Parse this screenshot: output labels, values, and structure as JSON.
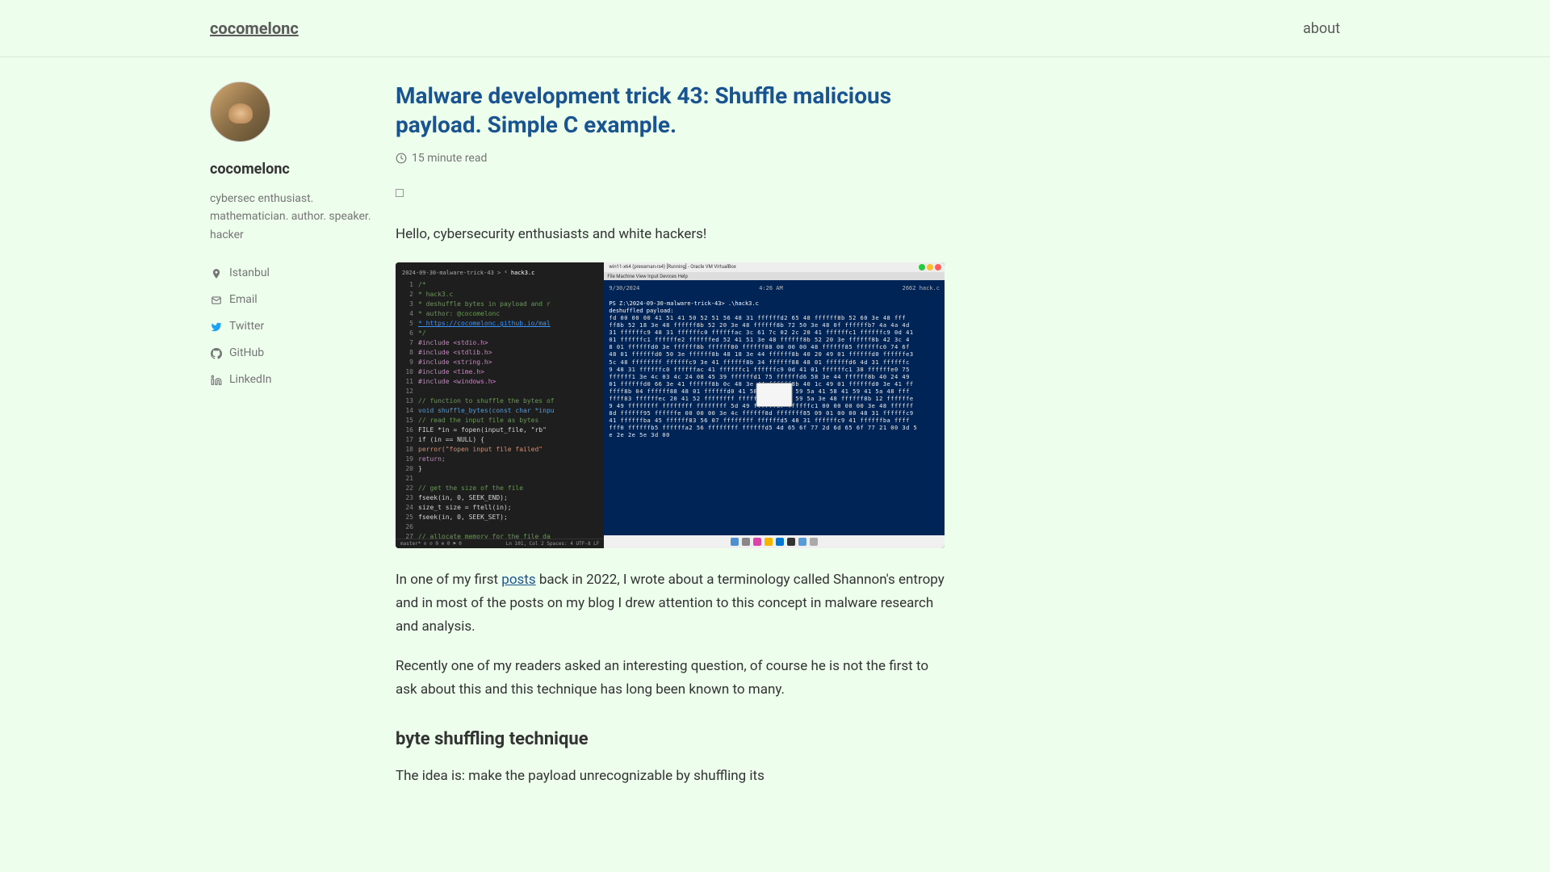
{
  "header": {
    "site_title": "cocomelonc",
    "nav_about": "about"
  },
  "sidebar": {
    "author_name": "cocomelonc",
    "author_bio": "cybersec enthusiast. mathematician. author. speaker. hacker",
    "location": "Istanbul",
    "links": {
      "email": "Email",
      "twitter": "Twitter",
      "github": "GitHub",
      "linkedin": "LinkedIn"
    }
  },
  "post": {
    "title": "Malware development trick 43: Shuffle malicious payload. Simple C example.",
    "read_time": "15 minute read",
    "greeting": "Hello, cybersecurity enthusiasts and white hackers!",
    "para1_prefix": "In one of my first ",
    "para1_link": "posts",
    "para1_suffix": " back in 2022, I wrote about a terminology called Shannon's entropy and in most of the posts on my blog I drew attention to this concept in malware research and analysis.",
    "para2": "Recently one of my readers asked an interesting question, of course he is not the first to ask about this and this technique has long been known to many.",
    "section1_title": "byte shuffling technique",
    "para3": "The idea is: make the payload unrecognizable by shuffling its",
    "image": {
      "tab_path": "2024-09-30-malware-trick-43 >",
      "tab_file": "hack3.c",
      "code_lines": [
        {
          "n": "1",
          "t": "/*",
          "cls": "kw-comment"
        },
        {
          "n": "2",
          "t": " * hack3.c",
          "cls": "kw-comment"
        },
        {
          "n": "3",
          "t": " * deshuffle bytes in payload and r",
          "cls": "kw-comment"
        },
        {
          "n": "4",
          "t": " * author: @cocomelonc",
          "cls": "kw-comment"
        },
        {
          "n": "5",
          "t": " * https://cocomelonc.github.io/mal",
          "cls": "kw-link"
        },
        {
          "n": "6",
          "t": "*/",
          "cls": "kw-comment"
        },
        {
          "n": "7",
          "t": "#include <stdio.h>",
          "cls": "kw-preproc"
        },
        {
          "n": "8",
          "t": "#include <stdlib.h>",
          "cls": "kw-preproc"
        },
        {
          "n": "9",
          "t": "#include <string.h>",
          "cls": "kw-preproc"
        },
        {
          "n": "10",
          "t": "#include <time.h>",
          "cls": "kw-preproc"
        },
        {
          "n": "11",
          "t": "#include <windows.h>",
          "cls": "kw-preproc"
        },
        {
          "n": "12",
          "t": "",
          "cls": ""
        },
        {
          "n": "13",
          "t": "// function to shuffle the bytes of",
          "cls": "kw-comment"
        },
        {
          "n": "14",
          "t": "void shuffle_bytes(const char *inpu",
          "cls": "kw-type"
        },
        {
          "n": "15",
          "t": "  // read the input file as bytes",
          "cls": "kw-comment"
        },
        {
          "n": "16",
          "t": "  FILE *in = fopen(input_file, \"rb\"",
          "cls": ""
        },
        {
          "n": "17",
          "t": "  if (in == NULL) {",
          "cls": ""
        },
        {
          "n": "18",
          "t": "    perror(\"fopen input file failed\"",
          "cls": "kw-str"
        },
        {
          "n": "19",
          "t": "    return;",
          "cls": "kw-preproc"
        },
        {
          "n": "20",
          "t": "  }",
          "cls": ""
        },
        {
          "n": "21",
          "t": "",
          "cls": ""
        },
        {
          "n": "22",
          "t": "  // get the size of the file",
          "cls": "kw-comment"
        },
        {
          "n": "23",
          "t": "  fseek(in, 0, SEEK_END);",
          "cls": ""
        },
        {
          "n": "24",
          "t": "  size_t size = ftell(in);",
          "cls": ""
        },
        {
          "n": "25",
          "t": "  fseek(in, 0, SEEK_SET);",
          "cls": ""
        },
        {
          "n": "26",
          "t": "",
          "cls": ""
        },
        {
          "n": "27",
          "t": "  // allocate memory for the file da",
          "cls": "kw-comment"
        }
      ],
      "terminal_title": "win11-x64 (pressman-rs4) [Running] - Oracle VM VirtualBox",
      "terminal_menu": "File  Machine  View  Input  Devices  Help",
      "terminal_date": "9/30/2024",
      "terminal_time": "4:26 AM",
      "terminal_size": "2662 hack.c",
      "terminal_prompt": "PS Z:\\2024-09-30-malware-trick-43> .\\hack3.c",
      "terminal_label": "deshuffled payload:",
      "hex_lines": [
        "fd 00 00 00 41 51 41 50 52 51 56 48 31 ffffffd2 65 48 ffffff8b 52 60 3e 48 fff",
        "ff8b 52 18 3e 48 ffffff8b 52 20 3e 48 ffffff8b 72 50 3e 48 0f ffffffb7 4a 4a 4d",
        "31 ffffffc9 48 31 ffffffc0 ffffffac 3c 61 7c 02 2c 20 41 ffffffc1 ffffffc9 0d 41",
        " 01 ffffffc1 ffffffe2 ffffffed 52 41 51 3e 48 ffffff8b 52 20 3e ffffff8b 42 3c 4",
        "8 01 ffffffd0 3e ffffff8b ffffff80 ffffff88 00 00 00 48 ffffff85 ffffffc0 74 6f",
        "48 01 ffffffd0 50 3e ffffff8b 48 18 3e 44 ffffff8b 40 20 49 01 ffffffd0 ffffffe3",
        " 5c 48 ffffffff ffffffc9 3e 41 ffffff8b 34 ffffff88 48 01 ffffffd6 4d 31 ffffffc",
        "9 48 31 ffffffc0 ffffffac 41 ffffffc1 ffffffc9 0d 41 01 ffffffc1 38 ffffffe0 75",
        "ffffff1 3e 4c 03 4c 24 08 45 39 ffffffd1 75 ffffffd6 58 3e 44 ffffff8b 40 24 49",
        "01 ffffffd0 66 3e 41 ffffff8b 0c 48 3e 44 ffffff8b 40 1c 49 01 ffffffd0 3e 41 ff",
        "ffff8b 04 ffffff88 48 01 ffffffd0 41 58 41 58 5e 59 5a 41 58 41 59 41 5a 48 fff",
        "ffff83 ffffffec 20 41 52 ffffffff ffffffe0 58 41 59 5a 3e 48 ffffff8b 12 ffffffe",
        "9 49 ffffffff ffffffff ffffffff 5d 49 ffffffc7 ffffffc1 00 00 00 00 3e 48 ffffff",
        "8d ffffff95 ffffffe 00 00 00 3e 4c ffffff8d fffffff85 09 01 00 00 48 31 ffffffc9",
        " 41 ffffffba 45 ffffff83 56 07 ffffffff ffffffd5 48 31 ffffffc9 41 ffffffba ffff",
        "fff0 ffffffb5 ffffffa2 56 ffffffff ffffffd5 4d 65 6f 77 2d 6d 65 6f 77 21 00 3d 5",
        "e 2e 2e 5e 3d 00"
      ],
      "status_left": "master* ⊙ ⊘ 0 ⊕ 0 ⚑ 0",
      "status_right": "Ln 101, Col 2   Spaces: 4   UTF-8   LF"
    }
  }
}
